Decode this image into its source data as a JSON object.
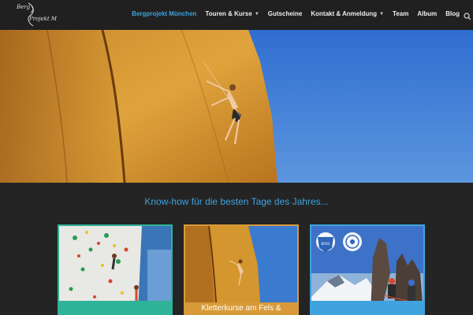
{
  "logo": {
    "line1": "Berg",
    "line2": "Projekt M"
  },
  "nav": {
    "items": [
      {
        "label": "Bergprojekt München",
        "active": true,
        "dropdown": false
      },
      {
        "label": "Touren & Kurse",
        "active": false,
        "dropdown": true
      },
      {
        "label": "Gutscheine",
        "active": false,
        "dropdown": false
      },
      {
        "label": "Kontakt & Anmeldung",
        "active": false,
        "dropdown": true
      },
      {
        "label": "Team",
        "active": false,
        "dropdown": false
      },
      {
        "label": "Album",
        "active": false,
        "dropdown": false
      },
      {
        "label": "Blog",
        "active": false,
        "dropdown": false
      }
    ],
    "search_icon": "search-icon"
  },
  "tagline": "Know-how für die besten Tage des Jahres...",
  "cards": [
    {
      "caption": "",
      "accent": "#2fb398"
    },
    {
      "caption": "Kletterkurse am Fels &",
      "accent": "#d89a38"
    },
    {
      "caption": "",
      "accent": "#3ea3de"
    }
  ],
  "colors": {
    "accent_blue": "#3ea3de",
    "header_bg": "#202020",
    "body_bg": "#242424"
  }
}
